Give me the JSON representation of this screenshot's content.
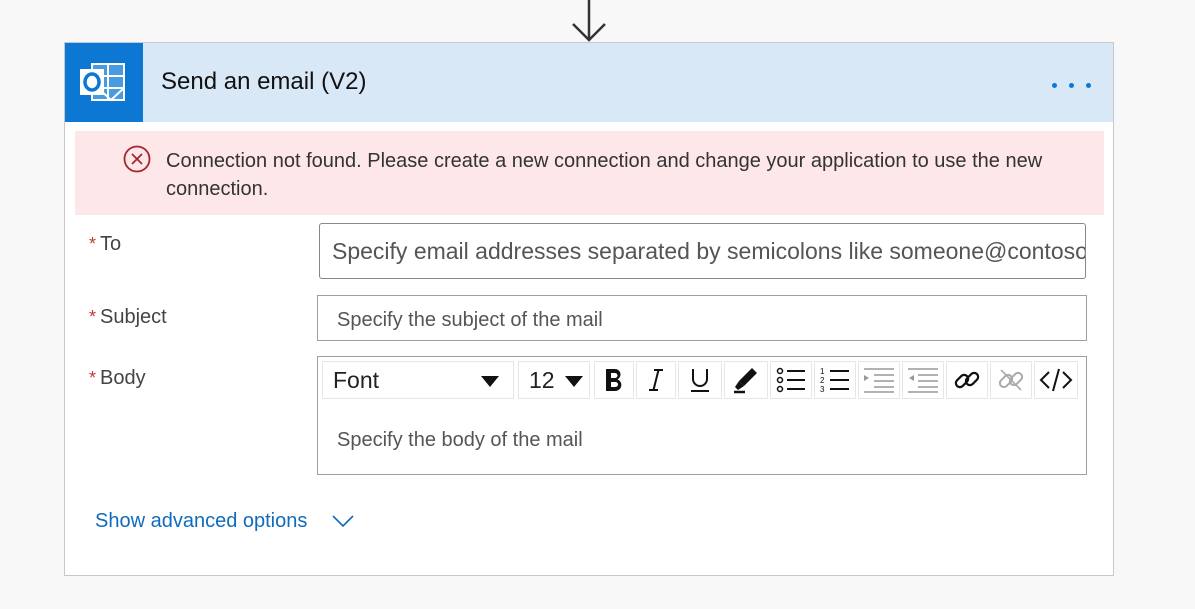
{
  "card": {
    "title": "Send an email (V2)",
    "app_icon": "outlook-icon",
    "accent_color": "#0d78d4",
    "header_color": "#d9e8f6"
  },
  "error": {
    "icon": "error-circle-icon",
    "message": "Connection not found. Please create a new connection and change your application to use the new connection."
  },
  "fields": {
    "to": {
      "label": "To",
      "required_mark": "*",
      "placeholder": "Specify email addresses separated by semicolons like someone@contoso.com"
    },
    "subject": {
      "label": "Subject",
      "required_mark": "*",
      "placeholder": "Specify the subject of the mail"
    },
    "body": {
      "label": "Body",
      "required_mark": "*",
      "placeholder": "Specify the body of the mail"
    }
  },
  "toolbar": {
    "font_value": "Font",
    "size_value": "12",
    "buttons": [
      "bold-icon",
      "italic-icon",
      "underline-icon",
      "highlight-icon",
      "bulleted-list-icon",
      "numbered-list-icon",
      "decrease-indent-icon",
      "increase-indent-icon",
      "link-icon",
      "unlink-icon",
      "code-view-icon"
    ]
  },
  "advanced": {
    "label": "Show advanced options"
  }
}
